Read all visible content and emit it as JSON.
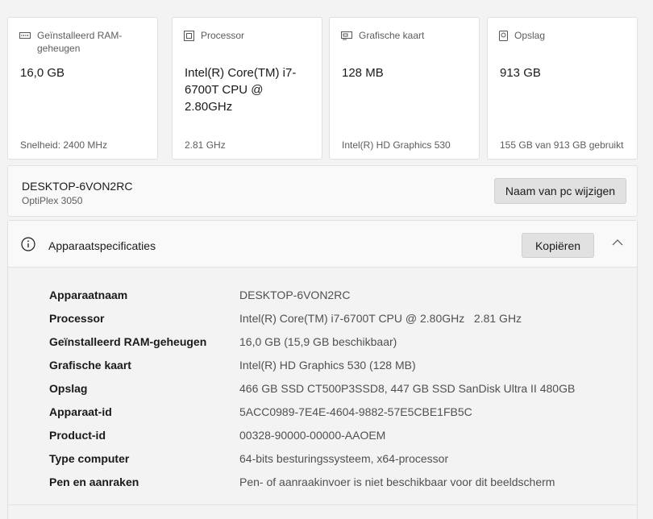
{
  "cards": [
    {
      "caption": "Geïnstalleerd RAM-geheugen",
      "value": "16,0 GB",
      "sub": "Snelheid: 2400 MHz",
      "icon": "ram-icon"
    },
    {
      "caption": "Processor",
      "value": "Intel(R) Core(TM) i7-6700T CPU @ 2.80GHz",
      "sub": "2.81 GHz",
      "icon": "processor-icon"
    },
    {
      "caption": "Grafische kaart",
      "value": "128 MB",
      "sub": "Intel(R) HD Graphics 530",
      "icon": "graphics-card-icon"
    },
    {
      "caption": "Opslag",
      "value": "913 GB",
      "sub": "155 GB van 913 GB gebruikt",
      "icon": "storage-icon"
    }
  ],
  "pc": {
    "name": "DESKTOP-6VON2RC",
    "model": "OptiPlex 3050",
    "rename_label": "Naam van pc wijzigen"
  },
  "specs": {
    "title": "Apparaatspecificaties",
    "copy_label": "Kopiëren",
    "rows": [
      {
        "key": "Apparaatnaam",
        "value": "DESKTOP-6VON2RC"
      },
      {
        "key": "Processor",
        "value": "Intel(R) Core(TM) i7-6700T CPU @ 2.80GHz   2.81 GHz"
      },
      {
        "key": "Geïnstalleerd RAM-geheugen",
        "value": "16,0 GB (15,9 GB beschikbaar)"
      },
      {
        "key": "Grafische kaart",
        "value": "Intel(R) HD Graphics 530 (128 MB)"
      },
      {
        "key": "Opslag",
        "value": "466 GB SSD CT500P3SSD8, 447 GB SSD SanDisk Ultra II 480GB"
      },
      {
        "key": "Apparaat-id",
        "value": "5ACC0989-7E4E-4604-9882-57E5CBE1FB5C"
      },
      {
        "key": "Product-id",
        "value": "00328-90000-00000-AAOEM"
      },
      {
        "key": "Type computer",
        "value": "64-bits besturingssysteem, x64-processor"
      },
      {
        "key": "Pen en aanraken",
        "value": "Pen- of aanraakinvoer is niet beschikbaar voor dit beeldscherm"
      }
    ]
  }
}
